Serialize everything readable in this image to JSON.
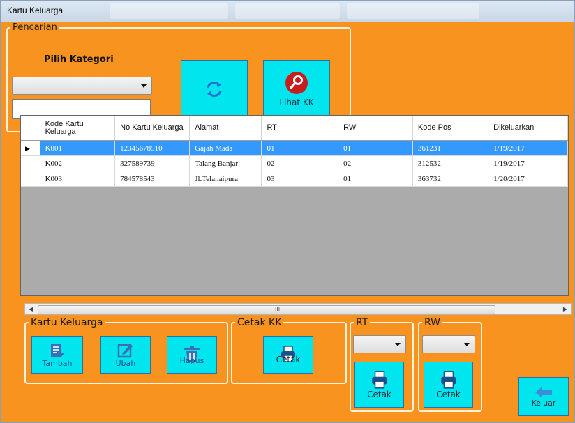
{
  "window": {
    "title": "Kartu Keluarga"
  },
  "search": {
    "legend": "Pencarian",
    "category_label": "Pilih Kategori",
    "category_value": "",
    "query_value": "",
    "lihat_label": "Lihat KK"
  },
  "table": {
    "columns": [
      "Kode Kartu Keluarga",
      "No Kartu Keluarga",
      "Alamat",
      "RT",
      "RW",
      "Kode Pos",
      "Dikeluarkan"
    ],
    "rows": [
      [
        "K001",
        "12345678910",
        "Gajah Mada",
        "01",
        "01",
        "361231",
        "1/19/2017"
      ],
      [
        "K002",
        "327589739",
        "Talang Banjar",
        "02",
        "02",
        "312532",
        "1/19/2017"
      ],
      [
        "K003",
        "784578543",
        "Jl.Telanaipura",
        "03",
        "01",
        "363732",
        "1/20/2017"
      ]
    ],
    "scroll_grip": "III"
  },
  "kk_group": {
    "legend": "Kartu Keluarga",
    "tambah": "Tambah",
    "ubah": "Ubah",
    "hapus": "Hapus"
  },
  "cetak_group": {
    "legend": "Cetak KK",
    "cetak": "Cetak"
  },
  "rt_group": {
    "legend": "RT",
    "value": "",
    "cetak": "Cetak"
  },
  "rw_group": {
    "legend": "RW",
    "value": "",
    "cetak": "Cetak"
  },
  "keluar_label": "Keluar",
  "colors": {
    "background": "#f7931e",
    "button": "#00e5ee",
    "selection": "#3399ff"
  }
}
